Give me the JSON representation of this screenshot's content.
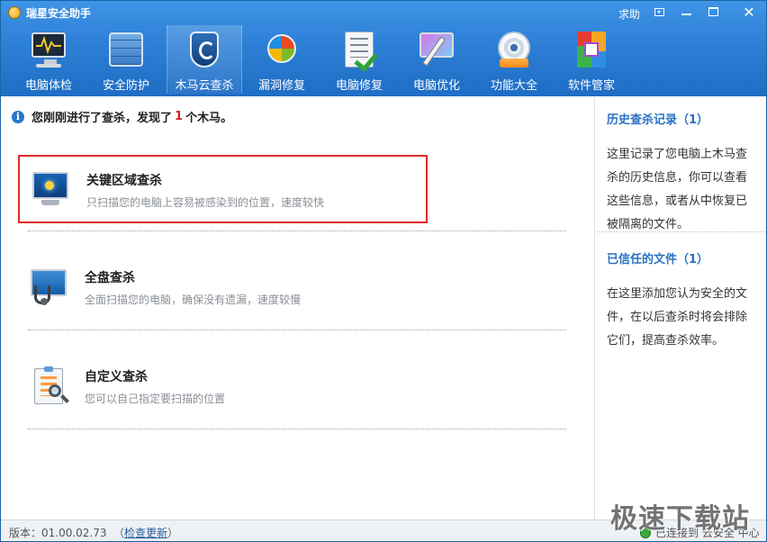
{
  "window": {
    "title": "瑞星安全助手",
    "help": "求助",
    "controls": [
      "menu",
      "minimize",
      "maximize",
      "close"
    ]
  },
  "toolbar": {
    "items": [
      {
        "label": "电脑体检",
        "icon": "health-check-monitor-icon"
      },
      {
        "label": "安全防护",
        "icon": "firewall-icon"
      },
      {
        "label": "木马云查杀",
        "icon": "shield-icon",
        "active": true
      },
      {
        "label": "漏洞修复",
        "icon": "windows-logo-icon"
      },
      {
        "label": "电脑修复",
        "icon": "checklist-icon"
      },
      {
        "label": "电脑优化",
        "icon": "magic-wand-icon"
      },
      {
        "label": "功能大全",
        "icon": "disc-toolbox-icon"
      },
      {
        "label": "软件管家",
        "icon": "app-blocks-icon"
      }
    ]
  },
  "notice": {
    "prefix": "您刚刚进行了查杀，发现了",
    "count": "1",
    "suffix": "个木马。"
  },
  "scan_options": [
    {
      "title": "关键区域查杀",
      "desc": "只扫描您的电脑上容易被感染到的位置，速度较快",
      "icon": "scan-monitor-icon",
      "selected": true
    },
    {
      "title": "全盘查杀",
      "desc": "全面扫描您的电脑，确保没有遗漏，速度较慢",
      "icon": "stethoscope-monitor-icon"
    },
    {
      "title": "自定义查杀",
      "desc": "您可以自己指定要扫描的位置",
      "icon": "clipboard-magnifier-icon"
    }
  ],
  "side": {
    "history_link": "历史查杀记录（1）",
    "history_text": "这里记录了您电脑上木马查杀的历史信息，你可以查看这些信息，或者从中恢复已被隔离的文件。",
    "trusted_link": "已信任的文件（1）",
    "trusted_text": "在这里添加您认为安全的文件，在以后查杀时将会排除它们，提高查杀效率。"
  },
  "status": {
    "version": "版本：01.00.02.73",
    "update_open": "（",
    "update_link": "检查更新",
    "update_close": "）",
    "connection": "已连接到 云安全 中心"
  },
  "watermark": "极速下载站",
  "colors": {
    "header_blue": "#2d7fd6",
    "link_blue": "#2a72c2",
    "highlight_red": "#e22b2b"
  }
}
